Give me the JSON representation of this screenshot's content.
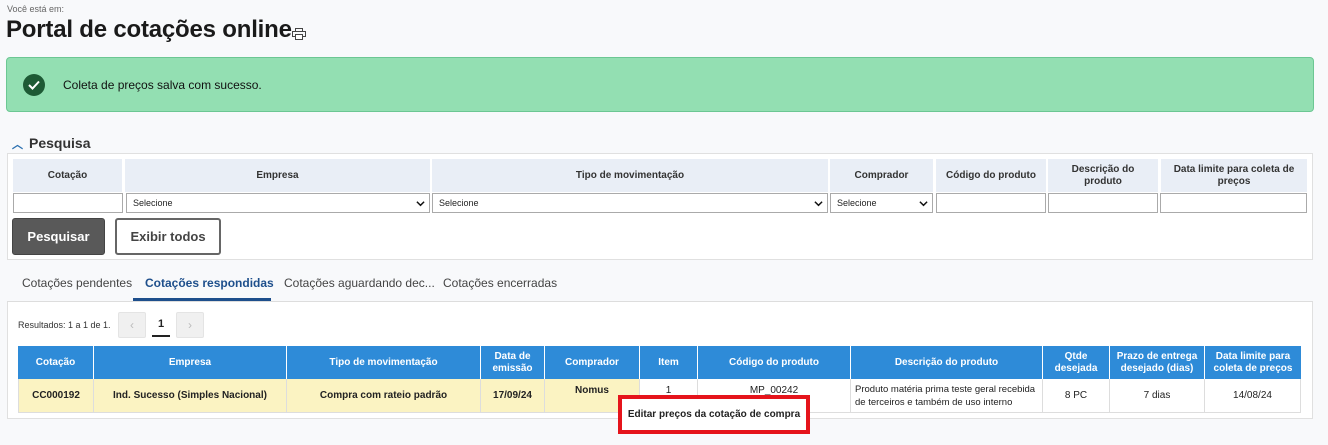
{
  "breadcrumb": "Você está em:",
  "title": "Portal de cotações online",
  "alert": {
    "message": "Coleta de preços salva com sucesso.",
    "color": "#93dfb2"
  },
  "search": {
    "heading": "Pesquisa",
    "columns": [
      "Cotação",
      "Empresa",
      "Tipo de movimentação",
      "Comprador",
      "Código do produto",
      "Descrição do produto",
      "Data limite para coleta de preços"
    ],
    "empresa_value": "Selecione",
    "tipo_value": "Selecione",
    "comprador_value": "Selecione",
    "search_button": "Pesquisar",
    "show_all_button": "Exibir todos"
  },
  "tabs": [
    {
      "label": "Cotações pendentes",
      "active": false
    },
    {
      "label": "Cotações respondidas",
      "active": true
    },
    {
      "label": "Cotações aguardando dec...",
      "active": false
    },
    {
      "label": "Cotações encerradas",
      "active": false
    }
  ],
  "results": {
    "summary": "Resultados: 1 a 1 de 1.",
    "pagination": {
      "prev": "‹",
      "current": "1",
      "next": "›"
    },
    "columns": [
      "Cotação",
      "Empresa",
      "Tipo de movimentação",
      "Data de emissão",
      "Comprador",
      "Item",
      "Código do produto",
      "Descrição do produto",
      "Qtde desejada",
      "Prazo de entrega desejado (dias)",
      "Data limite para coleta de preços"
    ],
    "rows": [
      {
        "cotacao": "CC000192",
        "empresa": "Ind. Sucesso (Simples Nacional)",
        "tipo": "Compra com rateio padrão",
        "data_emissao": "17/09/24",
        "comprador": "Nomus",
        "item": "1",
        "codigo": "MP_00242",
        "descricao": "Produto matéria prima teste geral recebida de terceiros e também de uso interno",
        "qtde": "8 PC",
        "prazo": "7 dias",
        "data_limite": "14/08/24"
      }
    ]
  },
  "context_menu": {
    "item": "Editar preços da cotação de compra"
  },
  "colors": {
    "header_blue": "#2e8bd8",
    "row_highlight": "#fbf3c2",
    "active_tab": "#1e4f8c",
    "highlight_border": "#e5141b"
  }
}
